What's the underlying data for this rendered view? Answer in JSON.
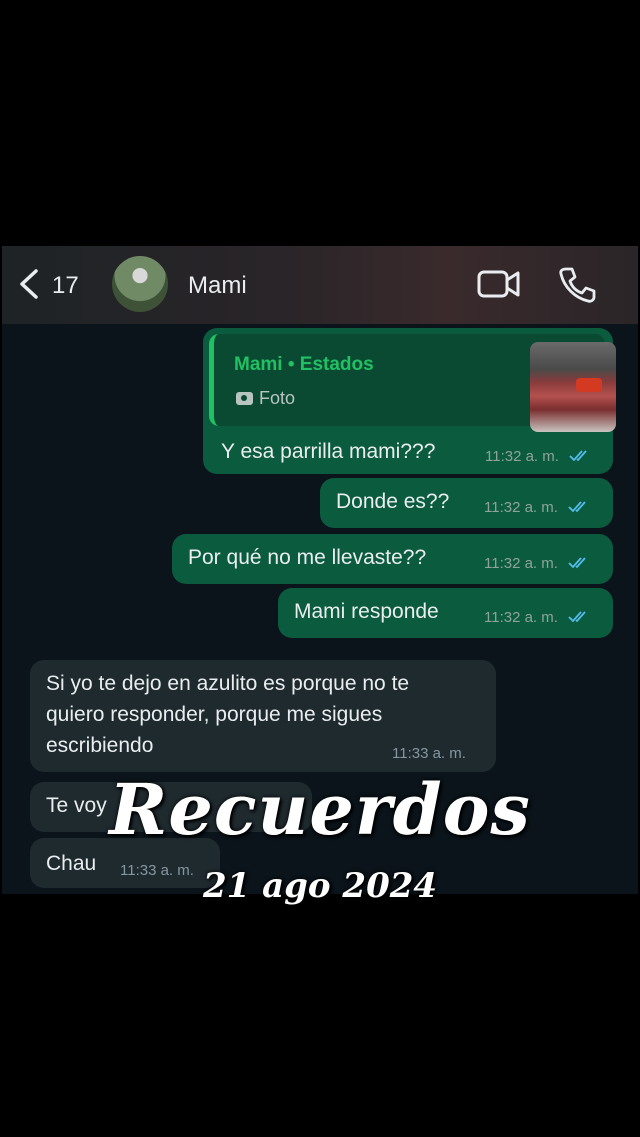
{
  "header": {
    "back_count": "17",
    "contact_name": "Mami"
  },
  "messages": {
    "quoted": {
      "title": "Mami • Estados",
      "subtitle": "Foto"
    },
    "out1": {
      "text": "Y esa parrilla mami???",
      "time": "11:32 a. m."
    },
    "out2": {
      "text": "Donde es??",
      "time": "11:32 a. m."
    },
    "out3": {
      "text": "Por qué no me llevaste??",
      "time": "11:32 a. m."
    },
    "out4": {
      "text": "Mami responde",
      "time": "11:32 a. m."
    },
    "in1": {
      "line1": "Si yo te dejo en azulito es porque no te",
      "line2": "quiero responder, porque me sigues",
      "line3": "escribiendo",
      "time": "11:33 a. m."
    },
    "in2": {
      "text": "Te voy"
    },
    "in3": {
      "text": "Chau",
      "time": "11:33 a. m."
    }
  },
  "overlay": {
    "title": "Recuerdos",
    "date": "21 ago 2024"
  },
  "colors": {
    "outgoing_bubble": "#0b5b3f",
    "incoming_bubble": "#1f2a2f",
    "read_ticks": "#53bdeb",
    "accent_green": "#21c063"
  },
  "icons": [
    "back-chevron-icon",
    "video-call-icon",
    "phone-icon",
    "camera-icon",
    "double-check-icon"
  ]
}
